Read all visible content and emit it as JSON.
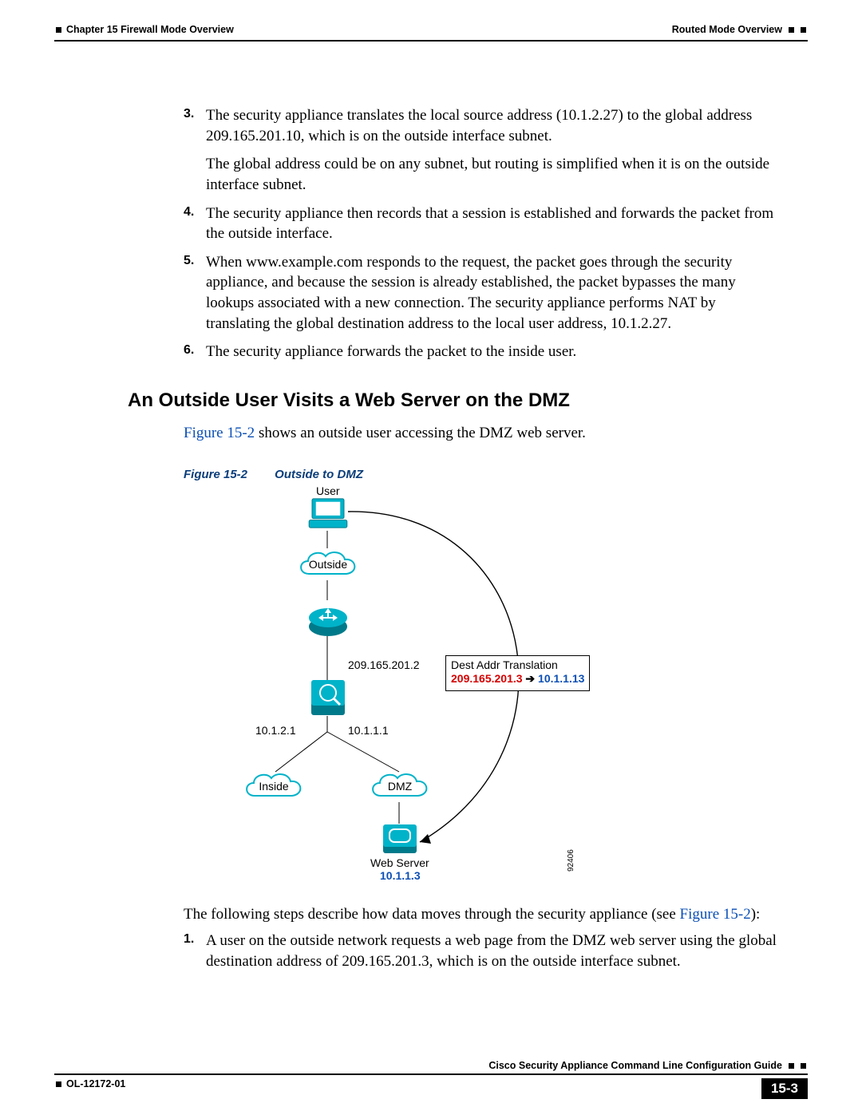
{
  "header": {
    "chapter": "Chapter 15    Firewall Mode Overview",
    "section": "Routed Mode Overview"
  },
  "steps_top": [
    {
      "n": "3.",
      "text": "The security appliance translates the local source address (10.1.2.27) to the global address 209.165.201.10, which is on the outside interface subnet."
    },
    {
      "n": "4.",
      "text": "The security appliance then records that a session is established and forwards the packet from the outside interface."
    },
    {
      "n": "5.",
      "text": "When www.example.com responds to the request, the packet goes through the security appliance, and because the session is already established, the packet bypasses the many lookups associated with a new connection. The security appliance performs NAT by translating the global destination address to the local user address, 10.1.2.27."
    },
    {
      "n": "6.",
      "text": "The security appliance forwards the packet to the inside user."
    }
  ],
  "para_after_3": "The global address could be on any subnet, but routing is simplified when it is on the outside interface subnet.",
  "h2": "An Outside User Visits a Web Server on the DMZ",
  "intro_pre": "Figure 15-2",
  "intro_post": " shows an outside user accessing the DMZ web server.",
  "figcap_label": "Figure 15-2",
  "figcap_title": "Outside to DMZ",
  "fig": {
    "user": "User",
    "outside": "Outside",
    "ip_top": "209.165.201.2",
    "ip_left": "10.1.2.1",
    "ip_right": "10.1.1.1",
    "inside": "Inside",
    "dmz": "DMZ",
    "webserver": "Web Server",
    "ws_ip": "10.1.1.3",
    "trans_title": "Dest Addr Translation",
    "trans_from": "209.165.201.3",
    "trans_to": "10.1.1.13",
    "diagnum": "92406"
  },
  "outro_pre": "The following steps describe how data moves through the security appliance (see ",
  "outro_link": "Figure 15-2",
  "outro_post": "):",
  "steps_bottom": [
    {
      "n": "1.",
      "text": "A user on the outside network requests a web page from the DMZ web server using the global destination address of 209.165.201.3, which is on the outside interface subnet."
    }
  ],
  "footer": {
    "guide": "Cisco Security Appliance Command Line Configuration Guide",
    "docid": "OL-12172-01",
    "pagenum": "15-3"
  }
}
